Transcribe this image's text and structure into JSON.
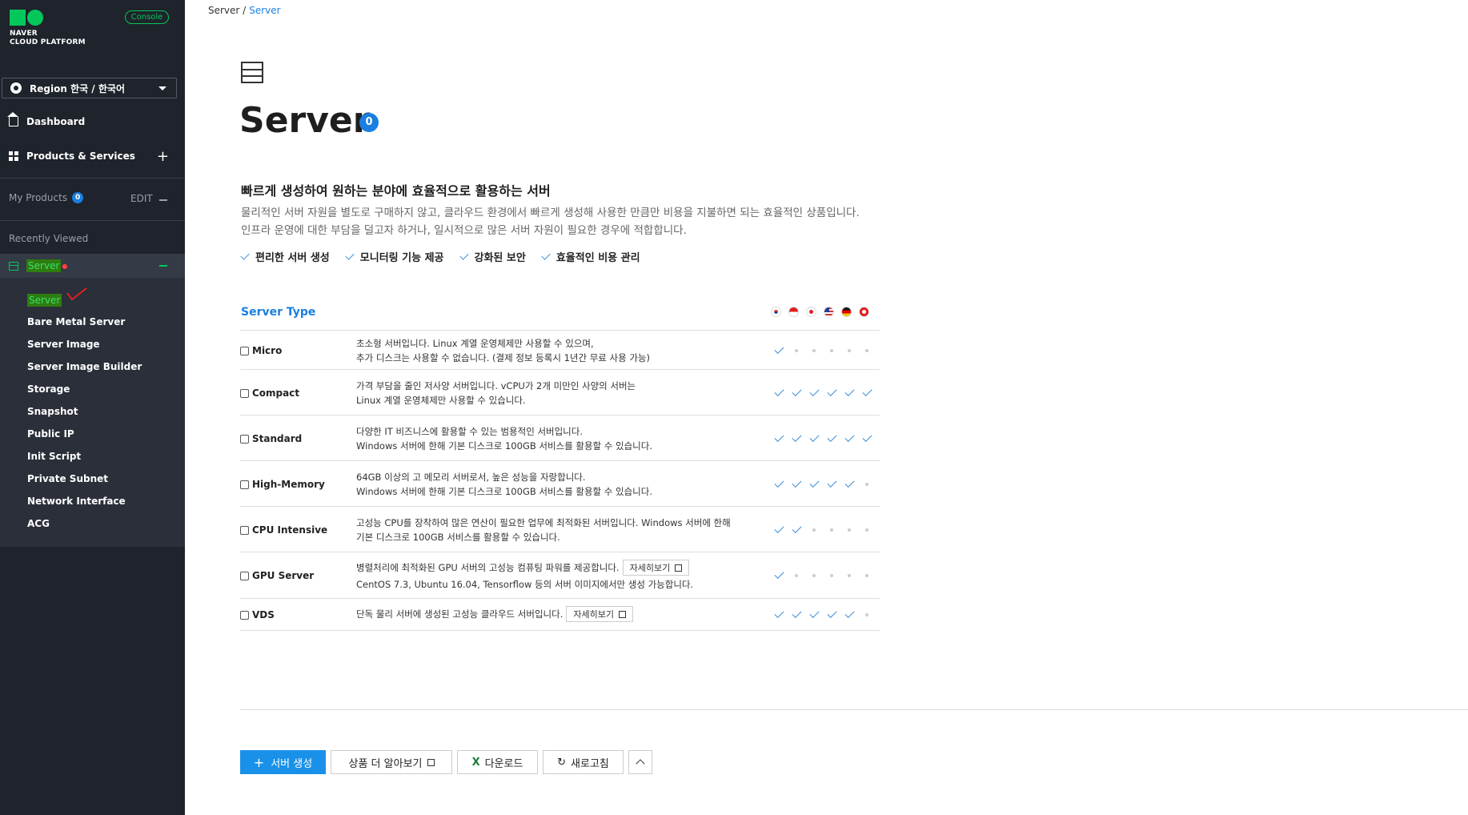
{
  "sidebar": {
    "brand_line1": "NAVER",
    "brand_line2": "CLOUD PLATFORM",
    "console_badge": "Console",
    "region_label": "Region 한국 / 한국어",
    "nav": [
      {
        "label": "Dashboard",
        "icon": "home-icon"
      },
      {
        "label": "Products & Services",
        "icon": "grid-icon"
      }
    ],
    "my_products_label": "My Products",
    "my_products_count": "0",
    "edit_label": "EDIT",
    "recently_viewed_label": "Recently Viewed",
    "server_group_label": "Server",
    "sub_items": [
      "Server",
      "Bare Metal Server",
      "Server Image",
      "Server Image Builder",
      "Storage",
      "Snapshot",
      "Public IP",
      "Init Script",
      "Private Subnet",
      "Network Interface",
      "ACG"
    ]
  },
  "breadcrumb": {
    "parent": "Server /",
    "current": "Server"
  },
  "page": {
    "title": "Server",
    "count": "0",
    "headline": "빠르게 생성하여 원하는 분야에 효율적으로 활용하는 서버",
    "desc_line1": "물리적인 서버 자원을 별도로 구매하지 않고, 클라우드 환경에서 빠르게 생성해 사용한 만큼만 비용을 지불하면 되는 효율적인 상품입니다.",
    "desc_line2": "인프라 운영에 대한 부담을 덜고자 하거나, 일시적으로 많은 서버 자원이 필요한 경우에 적합합니다.",
    "features": [
      "편리한 서버 생성",
      "모니터링 기능 제공",
      "강화된 보안",
      "효율적인 비용 관리"
    ]
  },
  "server_type": {
    "title": "Server Type",
    "regions": [
      "KR",
      "SG",
      "JP",
      "US",
      "DE",
      "HK"
    ],
    "rows": [
      {
        "name": "Micro",
        "d1": "초소형 서버입니다. Linux 계열 운영체제만 사용할 수 있으며,",
        "d2": "추가 디스크는 사용할 수 없습니다. (결제 정보 등록시 1년간 무료 사용 가능)",
        "avail": [
          1,
          0,
          0,
          0,
          0,
          0
        ]
      },
      {
        "name": "Compact",
        "d1": "가격 부담을 줄인 저사양 서버입니다. vCPU가 2개 미만인 사양의 서버는",
        "d2": "Linux 계열 운영체제만 사용할 수 있습니다.",
        "avail": [
          1,
          1,
          1,
          1,
          1,
          1
        ]
      },
      {
        "name": "Standard",
        "d1": "다양한 IT 비즈니스에 활용할 수 있는 범용적인 서버입니다.",
        "d2": "Windows 서버에 한해 기본 디스크로 100GB 서비스를 활용할 수 있습니다.",
        "avail": [
          1,
          1,
          1,
          1,
          1,
          1
        ]
      },
      {
        "name": "High-Memory",
        "d1": "64GB 이상의 고 메모리 서버로서, 높은 성능을 자랑합니다.",
        "d2": "Windows 서버에 한해 기본 디스크로 100GB 서비스를 활용할 수 있습니다.",
        "avail": [
          1,
          1,
          1,
          1,
          1,
          0
        ]
      },
      {
        "name": "CPU Intensive",
        "d1": "고성능 CPU를 장착하여 많은 연산이 필요한 업무에 최적화된 서버입니다. Windows 서버에 한해",
        "d2": "기본 디스크로 100GB 서비스를 활용할 수 있습니다.",
        "avail": [
          1,
          1,
          0,
          0,
          0,
          0
        ]
      },
      {
        "name": "GPU Server",
        "d1": "병렬처리에 최적화된 GPU 서버의 고성능 컴퓨팅 파워를 제공합니다.",
        "d2": "CentOS 7.3, Ubuntu 16.04, Tensorflow 등의 서버 이미지에서만 생성 가능합니다.",
        "avail": [
          1,
          0,
          0,
          0,
          0,
          0
        ]
      },
      {
        "name": "VDS",
        "d1": "단독 물리 서버에 생성된 고성능 클라우드 서버입니다.",
        "d2": "",
        "avail": [
          1,
          1,
          1,
          1,
          1,
          0
        ]
      }
    ],
    "detail_label": "자세히보기"
  },
  "actions": {
    "create": "서버 생성",
    "learn_more": "상품 더 알아보기",
    "download": "다운로드",
    "refresh": "새로고침"
  }
}
